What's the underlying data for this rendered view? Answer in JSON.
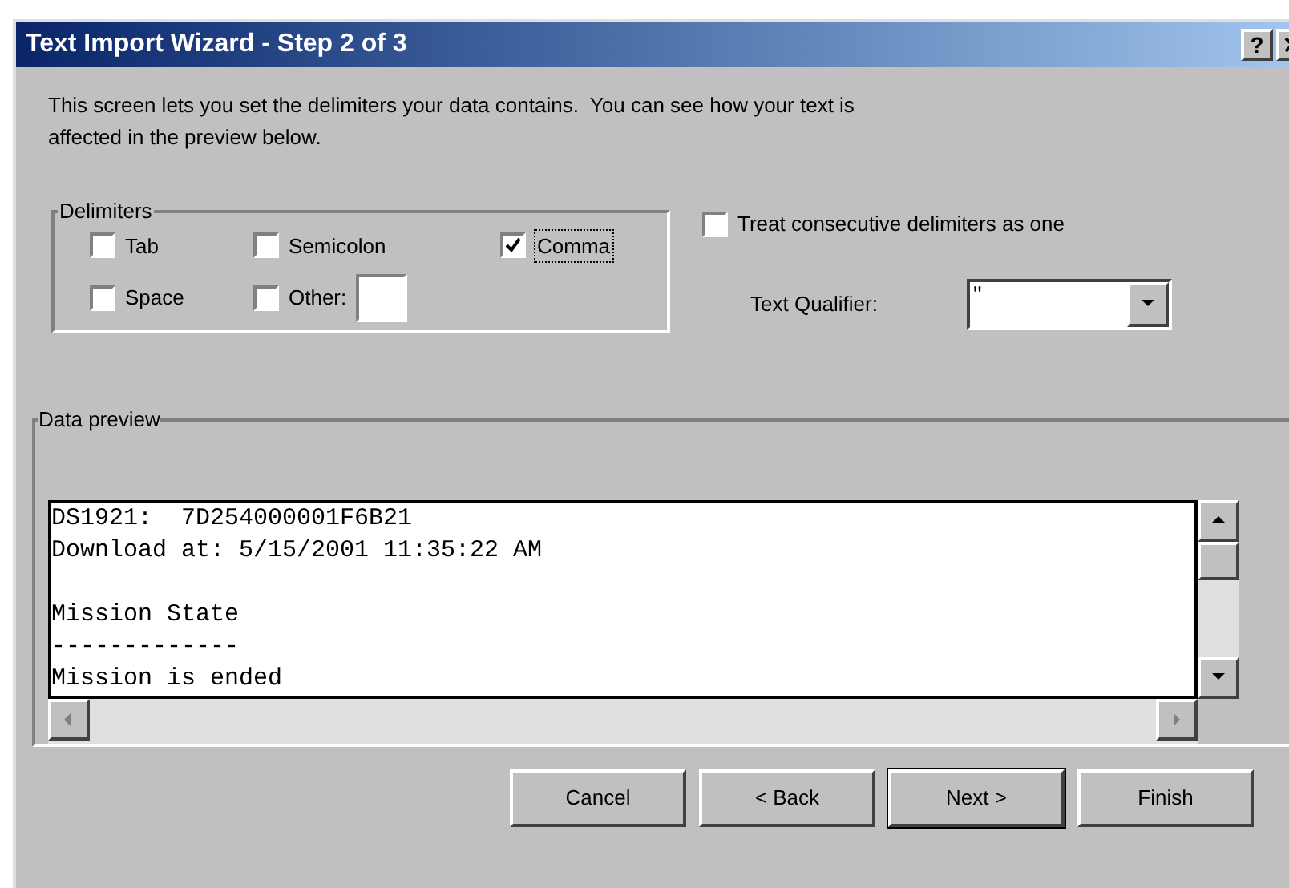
{
  "window": {
    "title": "Text Import Wizard - Step 2 of 3",
    "title_buttons": [
      "?"
    ]
  },
  "intro": "This screen lets you set the delimiters your data contains.  You can see how your text is affected in the preview below.",
  "delimiters": {
    "label": "Delimiters",
    "options": [
      {
        "label": "Tab",
        "checked": false
      },
      {
        "label": "Semicolon",
        "checked": false
      },
      {
        "label": "Comma",
        "checked": true
      },
      {
        "label": "Space",
        "checked": false
      },
      {
        "label": "Other:",
        "checked": false
      }
    ]
  },
  "treat_consecutive": {
    "label": "Treat consecutive delimiters as one",
    "checked": false
  },
  "text_qualifier": {
    "label": "Text Qualifier:",
    "value": "\""
  },
  "data_preview": {
    "label": "Data preview",
    "lines": [
      {
        "kind": "text",
        "text": "DS1921:  7D254000001F6B21"
      },
      {
        "kind": "text",
        "text": "Download at: 5/15/2001 11:35:22 AM"
      },
      {
        "kind": "blank"
      },
      {
        "kind": "text",
        "text": "Mission State"
      },
      {
        "kind": "text",
        "text": "-------------"
      },
      {
        "kind": "text",
        "text": "Mission is ended"
      }
    ]
  },
  "buttons": [
    {
      "label": "Cancel",
      "default": false
    },
    {
      "label": "< Back",
      "default": false
    },
    {
      "label": "Next >",
      "default": true
    },
    {
      "label": "Finish",
      "default": false
    }
  ]
}
